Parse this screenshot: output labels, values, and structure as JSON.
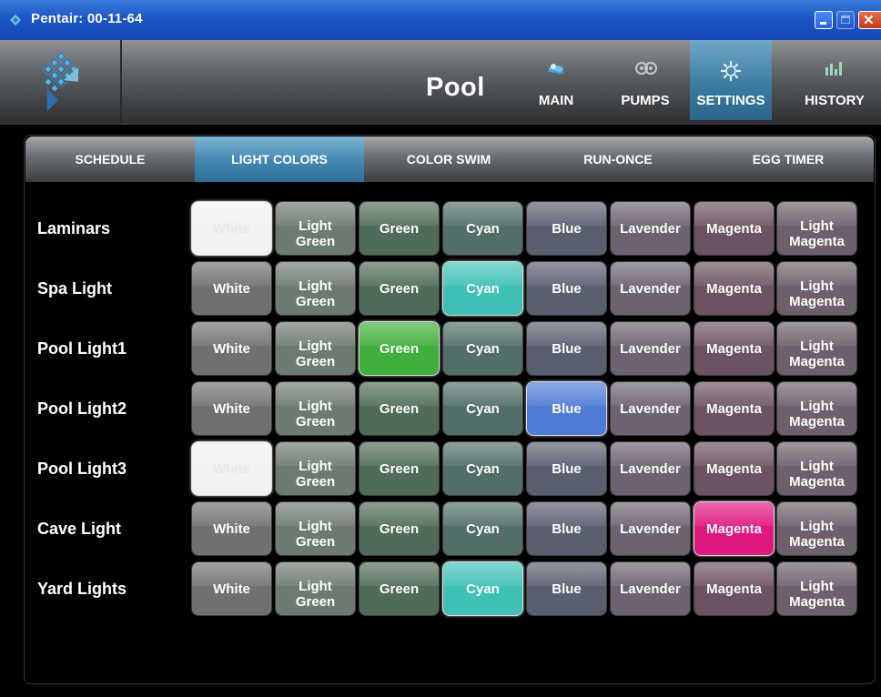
{
  "window": {
    "title": "Pentair: 00-11-64",
    "controls": [
      "minimize-icon",
      "maximize-icon",
      "close-icon"
    ]
  },
  "header": {
    "title": "Pool",
    "logo": "pentair-logo",
    "nav": [
      {
        "label": "MAIN",
        "icon": "pool-icon",
        "active": false
      },
      {
        "label": "PUMPS",
        "icon": "pumps-icon",
        "active": false
      },
      {
        "label": "SETTINGS",
        "icon": "gear-icon",
        "active": true
      },
      {
        "label": "HISTORY",
        "icon": "bar-chart-icon",
        "active": false
      }
    ]
  },
  "subtabs": [
    {
      "label": "SCHEDULE",
      "active": false
    },
    {
      "label": "LIGHT COLORS",
      "active": true
    },
    {
      "label": "COLOR SWIM",
      "active": false
    },
    {
      "label": "RUN-ONCE",
      "active": false
    },
    {
      "label": "EGG TIMER",
      "active": false
    }
  ],
  "colors": [
    {
      "label": "White",
      "muted": "#707070",
      "bright": "#f2f2f2"
    },
    {
      "label": "Light Green",
      "muted": "#6d7a70",
      "bright": "#b9e2b0"
    },
    {
      "label": "Green",
      "muted": "#506c58",
      "bright": "#3fae3a"
    },
    {
      "label": "Cyan",
      "muted": "#516e68",
      "bright": "#3ec1b4"
    },
    {
      "label": "Blue",
      "muted": "#5a5f70",
      "bright": "#4f7ad6"
    },
    {
      "label": "Lavender",
      "muted": "#6d6270",
      "bright": "#b494d6"
    },
    {
      "label": "Magenta",
      "muted": "#6c5363",
      "bright": "#e0187f"
    },
    {
      "label": "Light Magenta",
      "muted": "#6d5f6c",
      "bright": "#e3a2d6"
    }
  ],
  "rows": [
    {
      "label": "Laminars",
      "selected": 0
    },
    {
      "label": "Spa Light",
      "selected": 3
    },
    {
      "label": "Pool Light1",
      "selected": 2
    },
    {
      "label": "Pool Light2",
      "selected": 4
    },
    {
      "label": "Pool Light3",
      "selected": 0
    },
    {
      "label": "Cave Light",
      "selected": 6
    },
    {
      "label": "Yard Lights",
      "selected": 3
    }
  ]
}
